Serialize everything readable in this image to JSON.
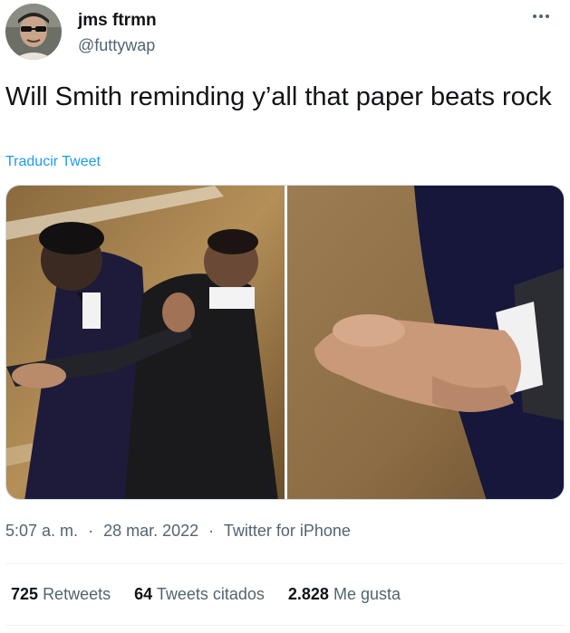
{
  "author": {
    "display_name": "jms ftrmn",
    "handle": "@futtywap"
  },
  "tweet": {
    "text": "Will Smith reminding y’all that paper beats rock",
    "translate_label": "Traducir Tweet"
  },
  "meta": {
    "time": "5:07 a. m.",
    "separator": "·",
    "date": "28 mar. 2022",
    "source": "Twitter for iPhone"
  },
  "stats": {
    "retweets_count": "725",
    "retweets_label": "Retweets",
    "quotes_count": "64",
    "quotes_label": "Tweets citados",
    "likes_count": "2.828",
    "likes_label": "Me gusta"
  },
  "icons": {
    "more": "more-options-icon"
  },
  "colors": {
    "text_primary": "#0f1419",
    "text_secondary": "#536471",
    "link": "#1d9bf0",
    "divider": "#eff3f4"
  }
}
